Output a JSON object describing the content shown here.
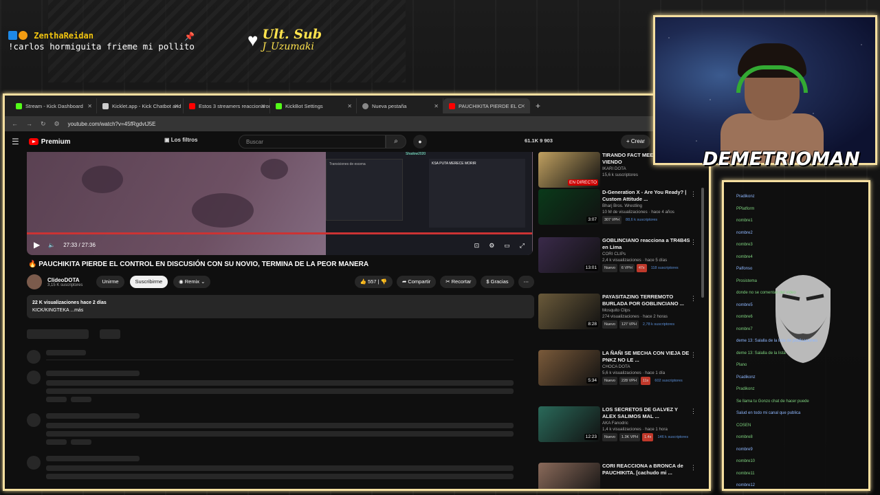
{
  "stream_overlay": {
    "alert": {
      "username": "ZenthaReidan",
      "badge_count": "1",
      "message": "!carlos hormiguita frieme mi pollito"
    },
    "ult_sub": {
      "line1": "Ult. Sub",
      "line2": "J_Uzumaki"
    },
    "streamer_name": "DEMETRIOMAN"
  },
  "browser": {
    "tabs": [
      {
        "label": "Stream - Kick Dashboard",
        "color": "#53fc18"
      },
      {
        "label": "Kicklet.app - Kick Chatbot and",
        "color": "#cccccc"
      },
      {
        "label": "Estos 3 streamers reaccionaron",
        "color": "#ff0000"
      },
      {
        "label": "KickBot Settings",
        "color": "#53fc18"
      },
      {
        "label": "Nueva pestaña",
        "color": "#888888"
      },
      {
        "label": "PAUCHIKITA PIERDE EL C",
        "color": "#ff0000"
      }
    ],
    "url": "youtube.com/watch?v=45fRgdvtJ5E"
  },
  "youtube": {
    "logo": "Premium",
    "filters": "Los filtros",
    "search_placeholder": "Buscar",
    "header_stats": "61.1K  9  903",
    "create": "Crear",
    "player": {
      "time": "27:33 / 27:36",
      "progress": 0.998,
      "obs_label": "Transiciones de escena",
      "obs_chat_user": "Shadow2020",
      "obs_chat_msg": "KSA PUTA MERECE MORIR"
    },
    "video_title": "PAUCHIKITA PIERDE EL CONTROL EN DISCUSIÓN CON SU NOVIO, TERMINA DE LA PEOR MANERA",
    "channel": {
      "name": "ClideoDOTA",
      "subs": "3,15 K suscriptores",
      "join": "Unirme",
      "subscribe": "Suscribirme",
      "remix": "Remix"
    },
    "actions": {
      "likes": "557",
      "share": "Compartir",
      "clip": "Recortar",
      "thanks": "Gracias"
    },
    "description": {
      "stats": "22 K visualizaciones  hace 2 días",
      "text": "KICK/KINGTEKA ...más"
    },
    "sidebar": [
      {
        "title": "TIRANDO FACT MEEPO SKINS Y VIENDO",
        "channel": "IKARI DOTA",
        "meta": "15,6 k suscriptores",
        "duration": "",
        "thumb": "#c0a060",
        "badge": "EN DIRECTO",
        "tags": []
      },
      {
        "title": "D-Generation X - Are You Ready? | Custom Attitude ...",
        "channel": "Bharj Bros. Wrestling",
        "meta": "10 M de visualizaciones · hace 4 años",
        "duration": "3:07",
        "thumb": "#0a3a1a",
        "tags": [
          "307 VPH",
          "88,6 k suscriptores"
        ]
      },
      {
        "title": "GOBLINCIANO reacciona a TR4B4S en Lima",
        "channel": "CORI CLIPs",
        "meta": "2,4 k visualizaciones · hace 5 días",
        "duration": "13:01",
        "thumb": "#3a2a4a",
        "tags": [
          "Nuevo",
          "6 VPH",
          "47x",
          "118 suscriptores"
        ]
      },
      {
        "title": "PAYASITAZING TERREMOTO BURLADA POR GOBLINCIANO ...",
        "channel": "Mosquito Clips",
        "meta": "274 visualizaciones · hace 2 horas",
        "duration": "8:28",
        "thumb": "#6a5a3a",
        "tags": [
          "Nuevo",
          "127 VPH",
          "2,78 k suscriptores"
        ]
      },
      {
        "title": "LA ÑAÑI SE MECHA CON VIEJA DE PNKZ NO LE ...",
        "channel": "CHOCA DOTA",
        "meta": "5,6 k visualizaciones · hace 1 día",
        "duration": "5:34",
        "thumb": "#7a5a3a",
        "tags": [
          "Nuevo",
          "228 VPH",
          "11x",
          "602 suscriptores"
        ]
      },
      {
        "title": "LOS SECRETOS DE GALVEZ Y ALEX SALIMOS MAL ...",
        "channel": "AKA Fanodric",
        "meta": "1,4 k visualizaciones · hace 1 hora",
        "duration": "12:23",
        "thumb": "#2a6a5a",
        "tags": [
          "Nuevo",
          "1.3K VPH",
          "1.4x",
          "146 k suscriptores"
        ]
      },
      {
        "title": "CORI REACCIONA a BRONCA de PAUCHIKITA. [cachudo mi ...",
        "channel": "",
        "meta": "",
        "duration": "",
        "thumb": "#8a6a5a",
        "tags": []
      }
    ]
  },
  "chat_overlay": {
    "lines": [
      "Pradikonz",
      "PPlatform",
      "nombre1",
      "nombre2",
      "nombre3",
      "nombre4",
      "Palfonso",
      "Prosistema",
      "donde no se comentan del video",
      "nombre5",
      "nombre6",
      "nombre7",
      "deme 13: Salalla de la lista de publicaciones",
      "deme 13: Salalla de la lista",
      "Plano",
      "Pcadikonz",
      "Pradikonz",
      "Se llama tu Gonzo chat de hacer puede",
      "Salud en todo mi canal que publica",
      "COSEN",
      "nombre8",
      "nombre9",
      "nombre10",
      "nombre11",
      "nombre12"
    ]
  }
}
